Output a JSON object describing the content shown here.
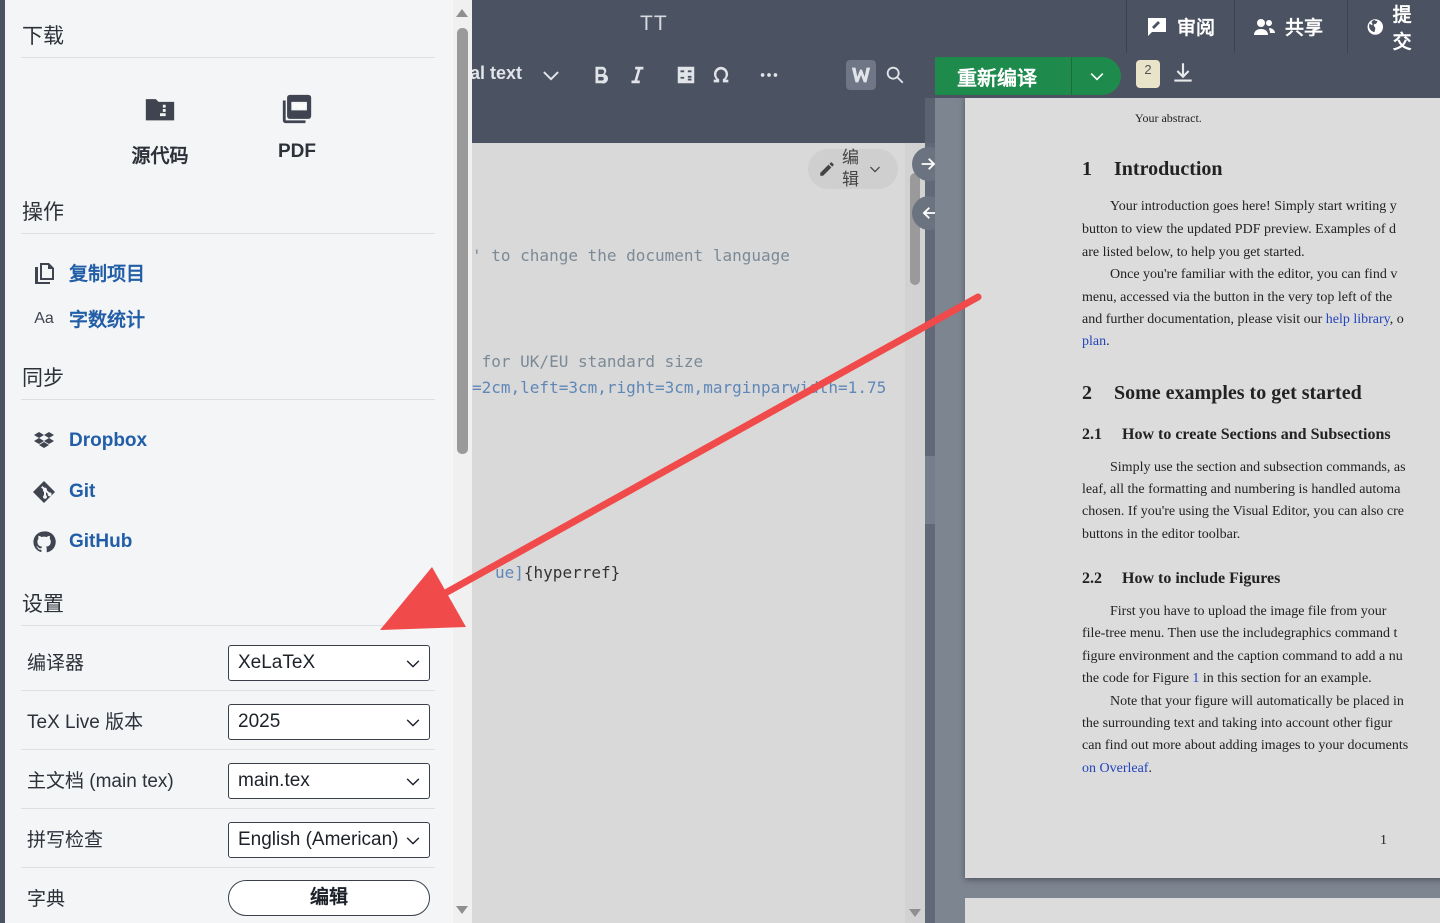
{
  "topbar": {
    "project_title": "TT",
    "review_label": "审阅",
    "share_label": "共享",
    "submit_label": "提交"
  },
  "editor_toolbar": {
    "style_label": "al text"
  },
  "editor": {
    "edit_mode_label": "编辑",
    "lines": {
      "l1": "' to change the document language",
      "l2": " for UK/EU standard size",
      "l3": "=2cm,left=3cm,right=3cm,marginparwidth=1.75",
      "l4a": "ue]",
      "l4b": "{hyperref}"
    }
  },
  "pdf_toolbar": {
    "recompile_label": "重新编译",
    "log_count": "2"
  },
  "pdf": {
    "abstract": "Your abstract.",
    "s1_num": "1",
    "s1_title": "Introduction",
    "p1": "Your introduction goes here!  Simply start writing y",
    "p2": "button to view the updated PDF preview.  Examples of d",
    "p3": "are listed below, to help you get started.",
    "p4": "Once you're familiar with the editor, you can find v",
    "p5": "menu, accessed via the button in the very top left of the",
    "p6a": "and further documentation, please visit our ",
    "p6b": "help library",
    "p6c": ", o",
    "p7": "plan",
    "p7b": ".",
    "s2_num": "2",
    "s2_title": "Some examples to get started",
    "s21_num": "2.1",
    "s21_title": "How to create Sections and Subsections",
    "p8": "Simply use the section and subsection commands, as",
    "p9": "leaf, all the formatting and numbering is handled automa",
    "p10": "chosen.  If you're using the Visual Editor, you can also cre",
    "p11": "buttons in the editor toolbar.",
    "s22_num": "2.2",
    "s22_title": "How to include Figures",
    "p12": "First you have to upload the image file from your",
    "p13": "file-tree menu.  Then use the includegraphics command t",
    "p14": "figure environment and the caption command to add a nu",
    "p15a": "the code for Figure ",
    "p15b": "1",
    "p15c": " in this section for an example.",
    "p16": "Note that your figure will automatically be placed in",
    "p17": "the surrounding text and taking into account other figur",
    "p18": "can find out more about adding images to your documents",
    "p19": "on Overleaf",
    "p19b": ".",
    "page_number": "1"
  },
  "menu": {
    "download_heading": "下载",
    "source_label": "源代码",
    "pdf_label": "PDF",
    "actions_heading": "操作",
    "copy_project_label": "复制项目",
    "word_count_icon_text": "Aa",
    "word_count_label": "字数统计",
    "sync_heading": "同步",
    "dropbox_label": "Dropbox",
    "git_label": "Git",
    "github_label": "GitHub",
    "settings_heading": "设置",
    "settings": [
      {
        "label": "编译器",
        "value": "XeLaTeX"
      },
      {
        "label": "TeX Live 版本",
        "value": "2025"
      },
      {
        "label": "主文档 (main tex)",
        "value": "main.tex"
      },
      {
        "label": "拼写检查",
        "value": "English (American)"
      },
      {
        "label": "字典",
        "value": "编辑"
      }
    ]
  },
  "colors": {
    "accent_link": "#225ea8",
    "recompile_green": "#1e8a4c",
    "arrow_red": "#f04a4a"
  }
}
